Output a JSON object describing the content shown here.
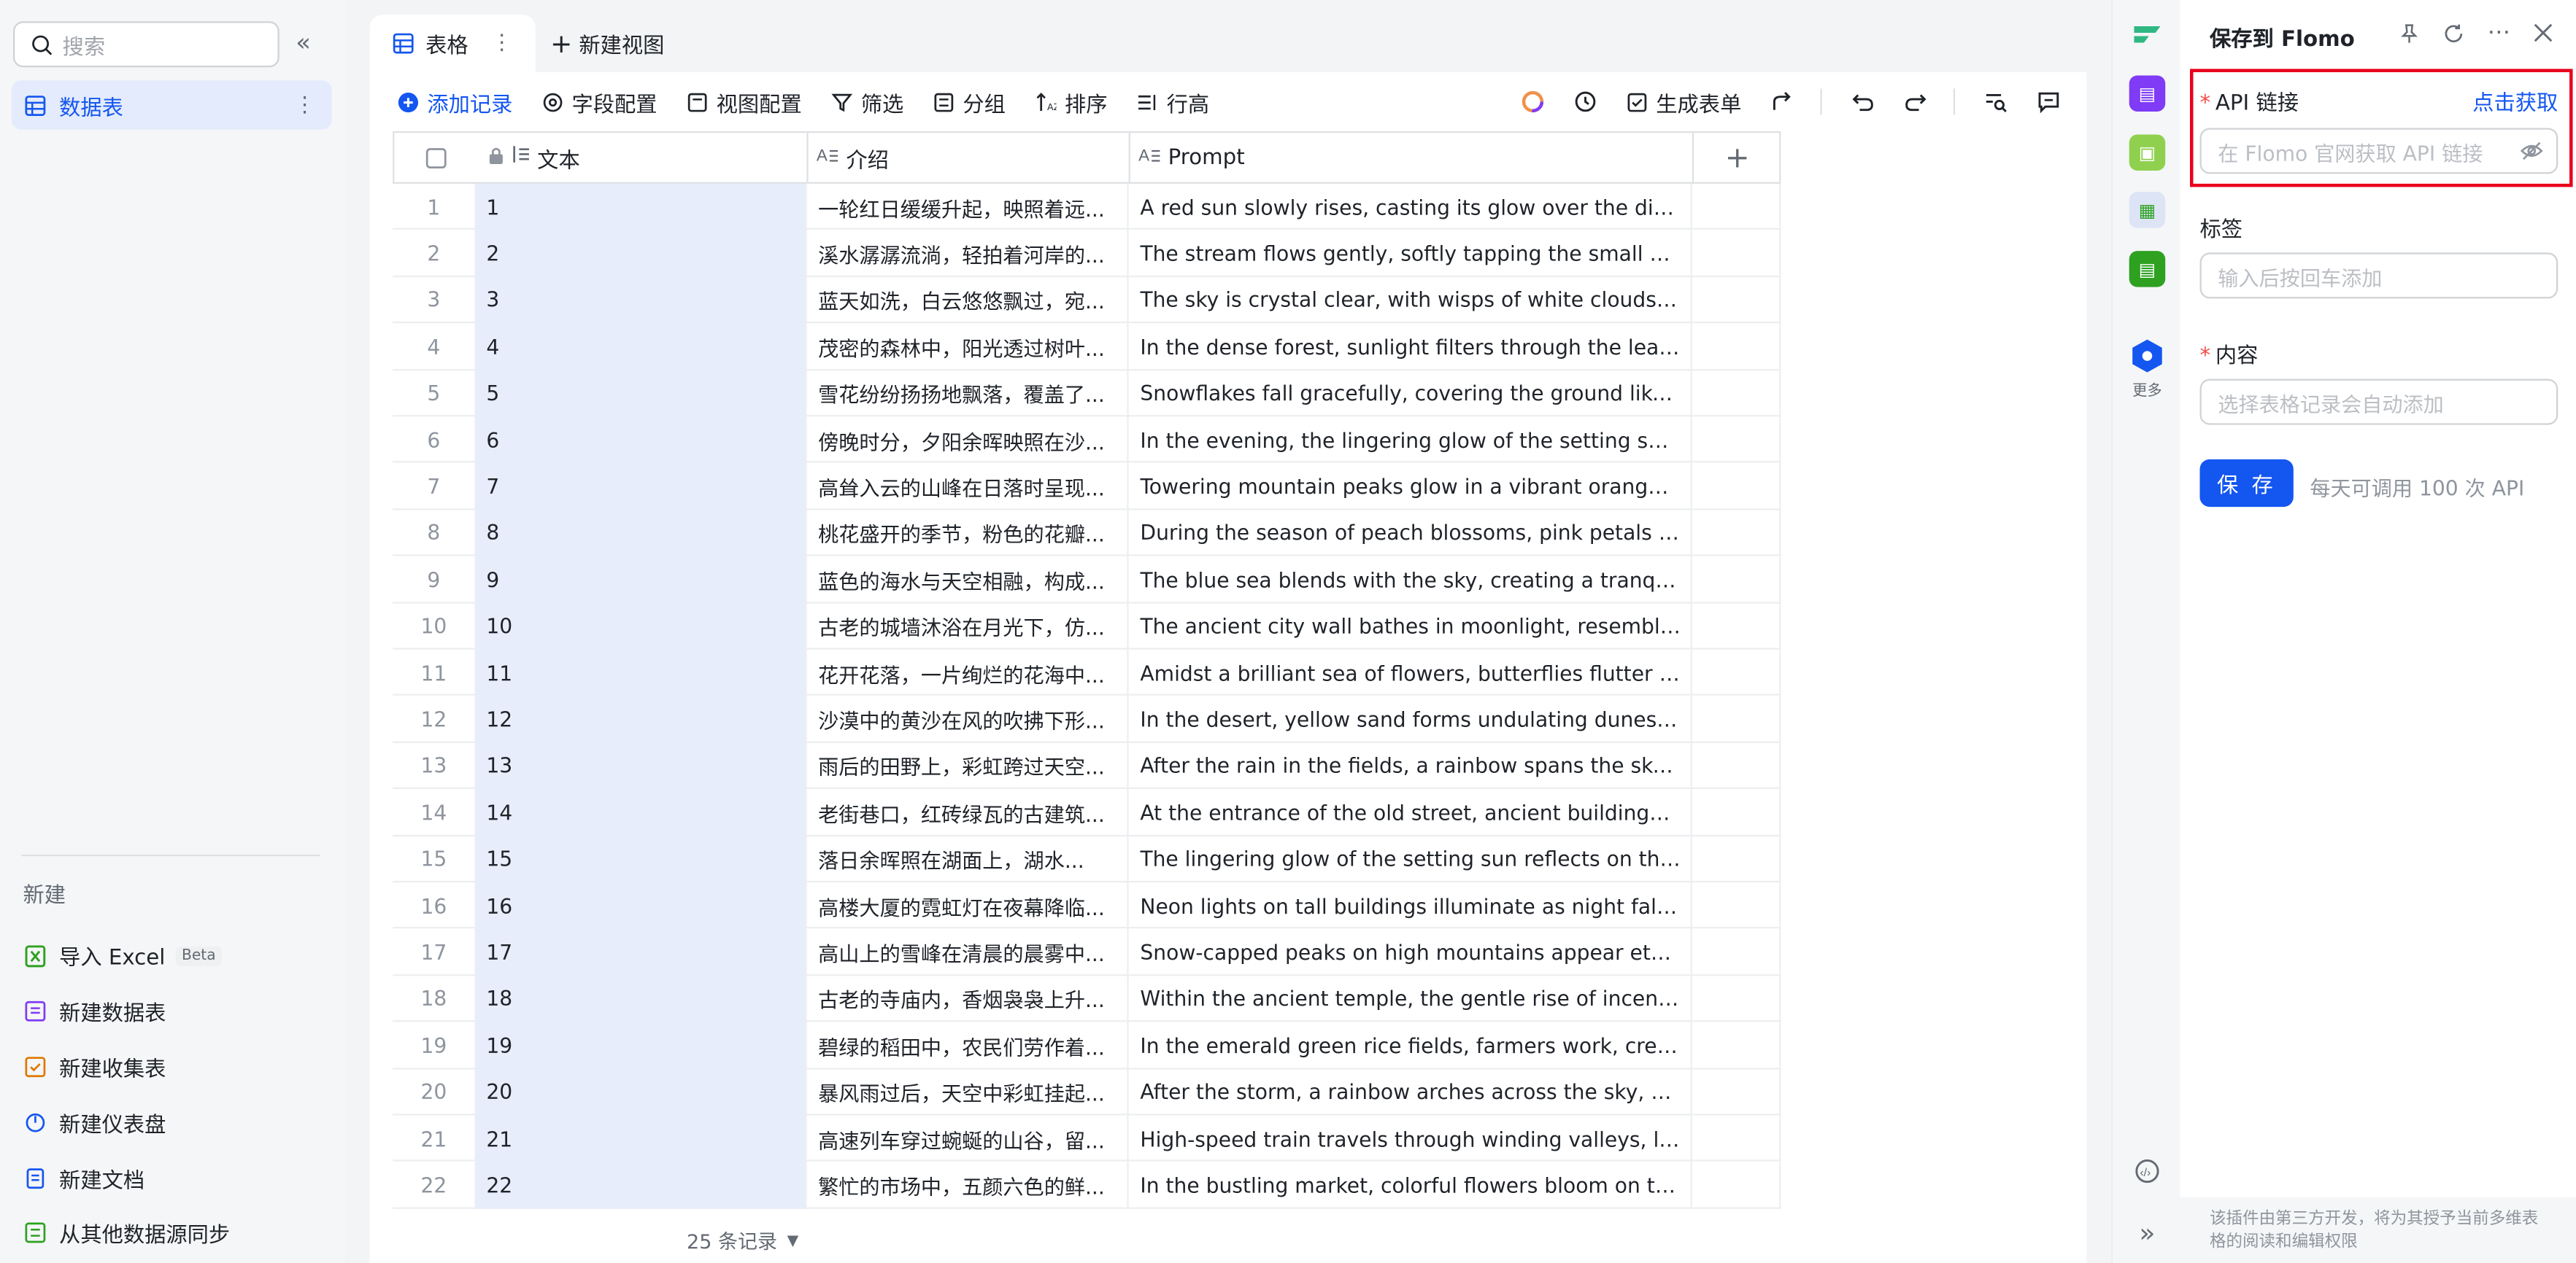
{
  "sidebar": {
    "search_placeholder": "搜索",
    "active_item": "数据表",
    "new_section_title": "新建",
    "new_items": [
      {
        "label": "导入 Excel",
        "badge": "Beta",
        "icon": "excel-icon"
      },
      {
        "label": "新建数据表",
        "icon": "table-icon"
      },
      {
        "label": "新建收集表",
        "icon": "form-icon"
      },
      {
        "label": "新建仪表盘",
        "icon": "dashboard-icon"
      },
      {
        "label": "新建文档",
        "icon": "doc-icon"
      },
      {
        "label": "从其他数据源同步",
        "icon": "sync-icon"
      }
    ]
  },
  "tabs": {
    "active": "表格",
    "new_view": "新建视图"
  },
  "toolbar": {
    "add_record": "添加记录",
    "field_config": "字段配置",
    "view_config": "视图配置",
    "filter": "筛选",
    "group": "分组",
    "sort": "排序",
    "row_height": "行高",
    "generate_form": "生成表单"
  },
  "grid": {
    "columns": [
      "文本",
      "介绍",
      "Prompt"
    ],
    "rows": [
      {
        "n": "1",
        "text": "1",
        "intro": "一轮红日缓缓升起，映照着远...",
        "prompt": "A red sun slowly rises, casting its glow over the distant ..."
      },
      {
        "n": "2",
        "text": "2",
        "intro": "溪水潺潺流淌，轻拍着河岸的...",
        "prompt": "The stream flows gently, softly tapping the small stones..."
      },
      {
        "n": "3",
        "text": "3",
        "intro": "蓝天如洗，白云悠悠飘过，宛...",
        "prompt": "The sky is crystal clear, with wisps of white clouds drifti..."
      },
      {
        "n": "4",
        "text": "4",
        "intro": "茂密的森林中，阳光透过树叶...",
        "prompt": "In the dense forest, sunlight filters through the leaves, ..."
      },
      {
        "n": "5",
        "text": "5",
        "intro": "雪花纷纷扬扬地飘落，覆盖了...",
        "prompt": "Snowflakes fall gracefully, covering the ground like a sil..."
      },
      {
        "n": "6",
        "text": "6",
        "intro": "傍晚时分，夕阳余晖映照在沙...",
        "prompt": "In the evening, the lingering glow of the setting sun refl..."
      },
      {
        "n": "7",
        "text": "7",
        "intro": "高耸入云的山峰在日落时呈现...",
        "prompt": "Towering mountain peaks glow in a vibrant orange hue ..."
      },
      {
        "n": "8",
        "text": "8",
        "intro": "桃花盛开的季节，粉色的花瓣...",
        "prompt": "During the season of peach blossoms, pink petals danc..."
      },
      {
        "n": "9",
        "text": "9",
        "intro": "蓝色的海水与天空相融，构成...",
        "prompt": "The blue sea blends with the sky, creating a tranquil an..."
      },
      {
        "n": "10",
        "text": "10",
        "intro": "古老的城墙沐浴在月光下，仿...",
        "prompt": "The ancient city wall bathes in moonlight, resembling a ..."
      },
      {
        "n": "11",
        "text": "11",
        "intro": "花开花落，一片绚烂的花海中...",
        "prompt": "Amidst a brilliant sea of flowers, butterflies flutter grace..."
      },
      {
        "n": "12",
        "text": "12",
        "intro": "沙漠中的黄沙在风的吹拂下形...",
        "prompt": "In the desert, yellow sand forms undulating dunes unde..."
      },
      {
        "n": "13",
        "text": "13",
        "intro": "雨后的田野上，彩虹跨过天空...",
        "prompt": "After the rain in the fields, a rainbow spans the sky, res..."
      },
      {
        "n": "14",
        "text": "14",
        "intro": "老街巷口，红砖绿瓦的古建筑...",
        "prompt": "At the entrance of the old street, ancient buildings with ..."
      },
      {
        "n": "15",
        "text": "15",
        "intro": "落日余晖照在湖面上，湖水...",
        "prompt": "The lingering glow of the setting sun reflects on the lak..."
      },
      {
        "n": "16",
        "text": "16",
        "intro": "高楼大厦的霓虹灯在夜幕降临...",
        "prompt": "Neon lights on tall buildings illuminate as night falls, da..."
      },
      {
        "n": "17",
        "text": "17",
        "intro": "高山上的雪峰在清晨的晨雾中...",
        "prompt": "Snow-capped peaks on high mountains appear etherea..."
      },
      {
        "n": "18",
        "text": "18",
        "intro": "古老的寺庙内，香烟袅袅上升...",
        "prompt": "Within the ancient temple, the gentle rise of incense sm..."
      },
      {
        "n": "19",
        "text": "19",
        "intro": "碧绿的稻田中，农民们劳作着...",
        "prompt": "In the emerald green rice fields, farmers work, creating ..."
      },
      {
        "n": "20",
        "text": "20",
        "intro": "暴风雨过后，天空中彩虹挂起...",
        "prompt": "After the storm, a rainbow arches across the sky, symb..."
      },
      {
        "n": "21",
        "text": "21",
        "intro": "高速列车穿过蜿蜒的山谷，留...",
        "prompt": "High-speed train travels through winding valleys, leavin..."
      },
      {
        "n": "22",
        "text": "22",
        "intro": "繁忙的市场中，五颜六色的鲜...",
        "prompt": "In the bustling market, colorful flowers bloom on the st..."
      }
    ],
    "record_count": "25 条记录"
  },
  "rail": {
    "more_label": "更多"
  },
  "panel": {
    "title": "保存到 Flomo",
    "api_label": "API 链接",
    "api_link": "点击获取",
    "api_placeholder": "在 Flomo 官网获取 API 链接",
    "tags_label": "标签",
    "tags_placeholder": "输入后按回车添加",
    "content_label": "内容",
    "content_placeholder": "选择表格记录会自动添加",
    "save_button": "保 存",
    "save_note": "每天可调用 100 次 API",
    "footer_note": "该插件由第三方开发，将为其授予当前多维表格的阅读和编辑权限"
  },
  "colors": {
    "accent": "#1456f0",
    "highlight_border": "#e8001c",
    "required_mark": "#f54a45"
  }
}
